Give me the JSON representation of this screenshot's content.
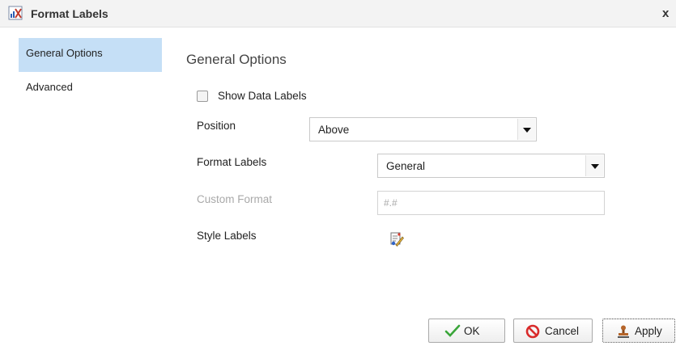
{
  "window": {
    "title": "Format Labels",
    "close_label": "x"
  },
  "sidebar": {
    "items": [
      {
        "label": "General Options",
        "active": true
      },
      {
        "label": "Advanced",
        "active": false
      }
    ]
  },
  "main": {
    "section_title": "General Options",
    "show_data_labels": {
      "label": "Show Data Labels",
      "checked": false
    },
    "position": {
      "label": "Position",
      "value": "Above"
    },
    "format_labels": {
      "label": "Format Labels",
      "value": "General"
    },
    "custom_format": {
      "label": "Custom Format",
      "placeholder": "#.#",
      "disabled": true
    },
    "style_labels": {
      "label": "Style Labels",
      "icon": "style-edit-icon"
    }
  },
  "footer": {
    "ok_label": "OK",
    "cancel_label": "Cancel",
    "apply_label": "Apply"
  },
  "colors": {
    "active_nav": "#c5dff6",
    "ok_check": "#3aa63a",
    "cancel_red": "#d92b2b"
  }
}
